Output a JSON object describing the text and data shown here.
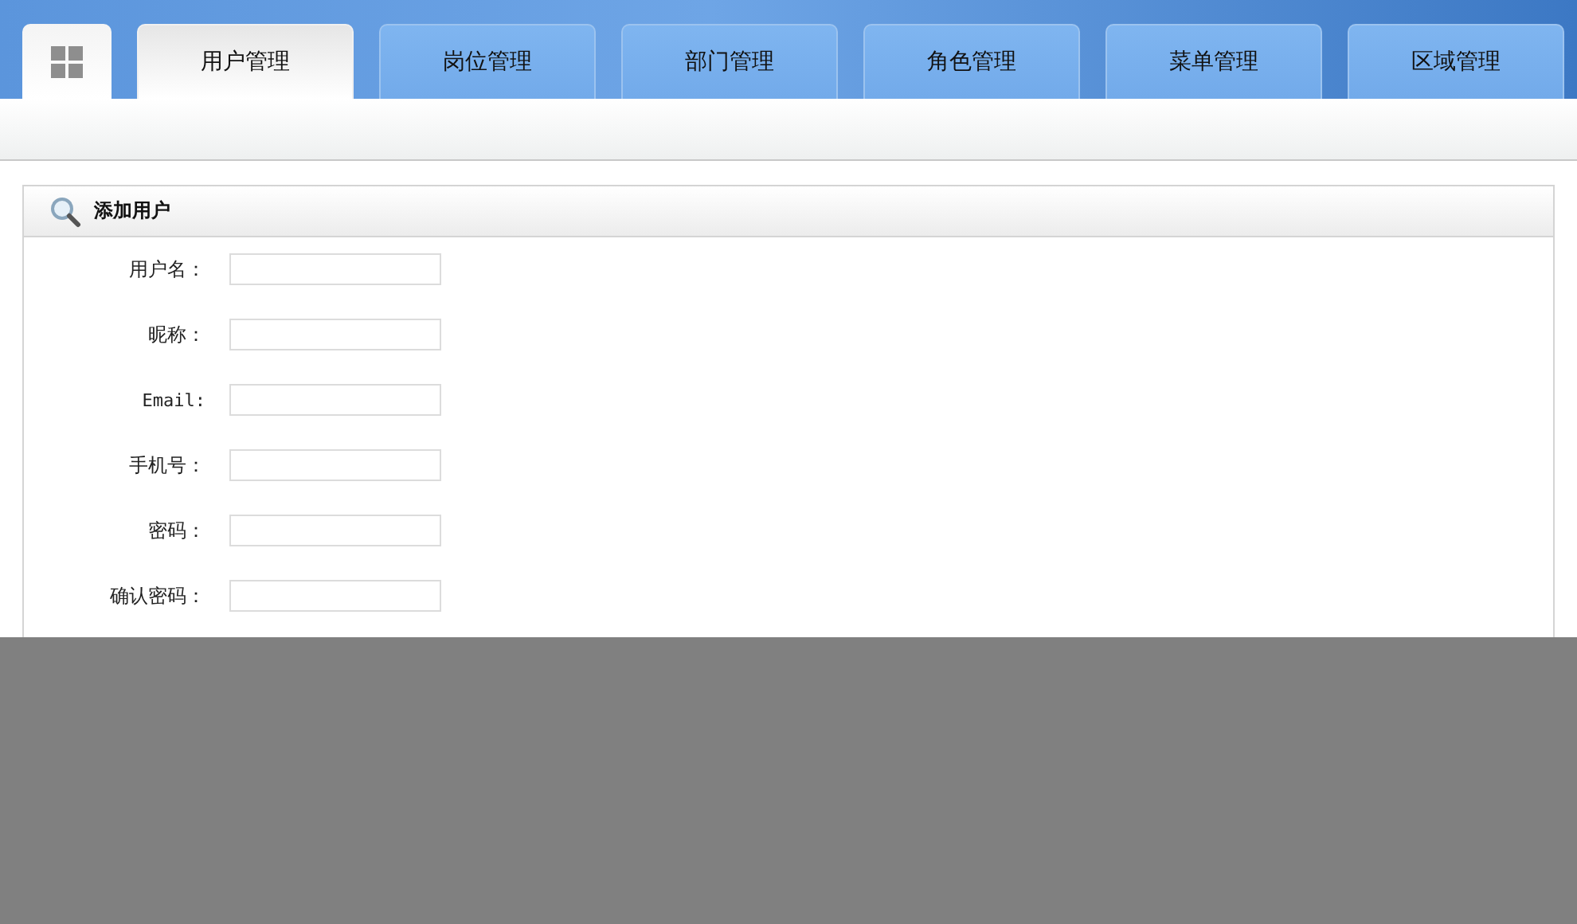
{
  "tabs": [
    {
      "label": "用户管理",
      "selected": true
    },
    {
      "label": "岗位管理",
      "selected": false
    },
    {
      "label": "部门管理",
      "selected": false
    },
    {
      "label": "角色管理",
      "selected": false
    },
    {
      "label": "菜单管理",
      "selected": false
    },
    {
      "label": "区域管理",
      "selected": false
    }
  ],
  "panel": {
    "title": "添加用户",
    "fields": [
      {
        "label": "用户名：",
        "kind": "text"
      },
      {
        "label": "昵称：",
        "kind": "text"
      },
      {
        "label": "Email:",
        "kind": "text"
      },
      {
        "label": "手机号：",
        "kind": "text"
      },
      {
        "label": "密码：",
        "kind": "text"
      },
      {
        "label": "确认密码：",
        "kind": "text"
      }
    ]
  }
}
